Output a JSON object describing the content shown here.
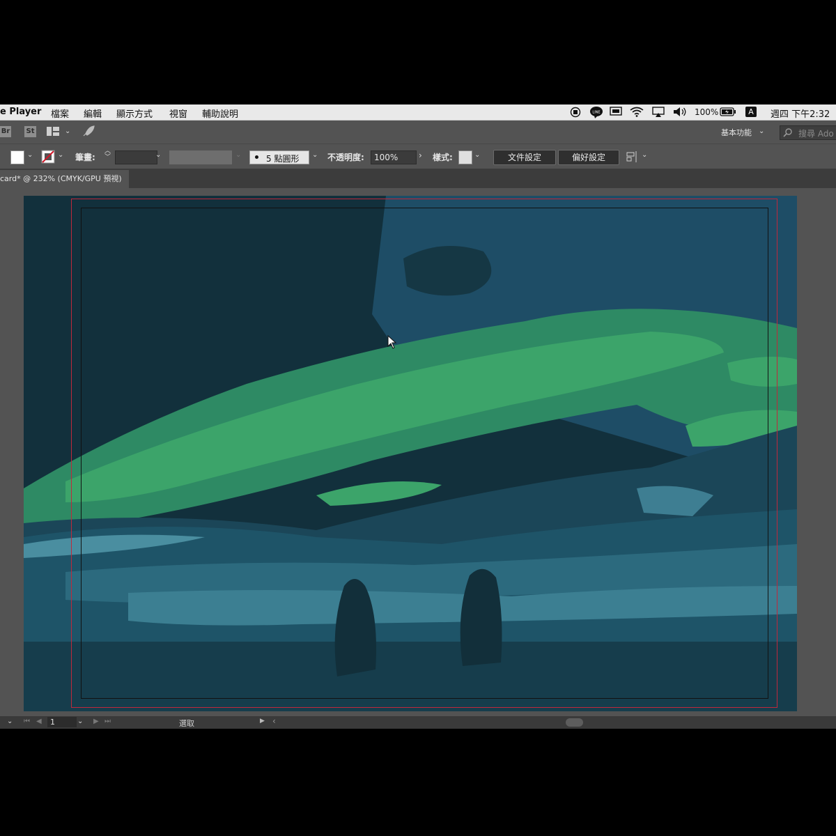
{
  "menubar": {
    "app_name": "e Player",
    "menus": [
      "檔案",
      "編輯",
      "顯示方式",
      "視窗",
      "輔助說明"
    ],
    "battery": "100%",
    "input_method": "A",
    "clock": "週四 下午2:32"
  },
  "appbar": {
    "bridge_label": "Br",
    "stock_label": "St",
    "workspace_label": "基本功能",
    "search_placeholder": "搜尋 Ado"
  },
  "control_bar": {
    "stroke_label": "筆畫:",
    "brush_label": "5 點圓形",
    "opacity_label": "不透明度:",
    "opacity_value": "100%",
    "style_label": "樣式:",
    "doc_setup_button": "文件設定",
    "preferences_button": "偏好設定"
  },
  "document_tab": {
    "title": "card* @ 232% (CMYK/GPU 預視)"
  },
  "status_bar": {
    "artboard_number": "1",
    "tool_label": "選取"
  },
  "colors": {
    "fill_swatch": "#ffffff",
    "stroke_none": "#d3182a",
    "bleed_guide": "#c0283c",
    "aurora_bright": "#3ca46a",
    "aurora_mid": "#2e8a64",
    "sky_dark": "#12303c",
    "sky_mid": "#1e4d66",
    "ground_light": "#4a8ea0"
  },
  "icons": [
    "record-icon",
    "line-app-icon",
    "display-icon",
    "wifi-icon",
    "airplay-icon",
    "volume-icon",
    "battery-icon",
    "workspace-layout-icon",
    "rocket-icon",
    "search-icon",
    "align-icon",
    "mouse-cursor-icon"
  ]
}
